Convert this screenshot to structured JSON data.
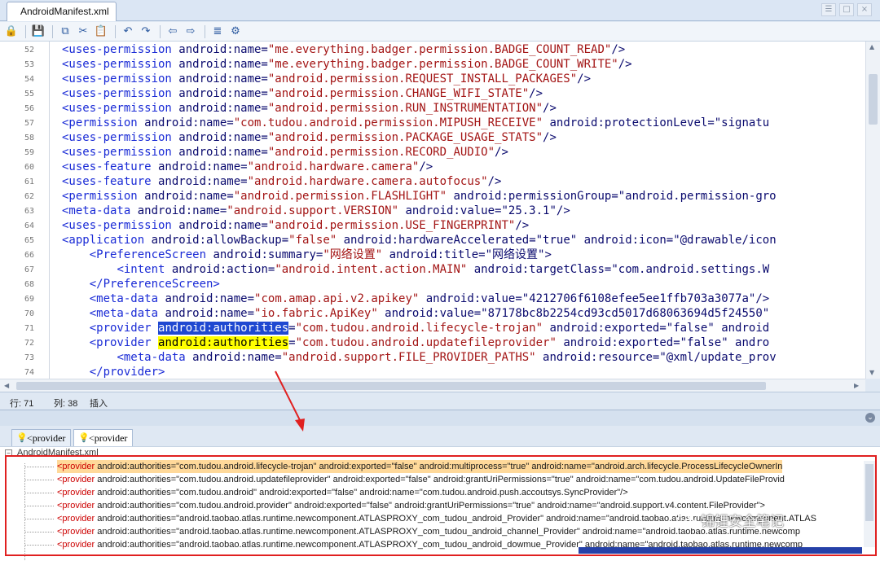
{
  "window": {
    "tab_title": "AndroidManifest.xml",
    "controls": [
      "☰",
      "□",
      "×"
    ]
  },
  "toolbar": {
    "icons": [
      {
        "name": "lock-icon",
        "glyph": "🔒"
      },
      {
        "name": "save-icon",
        "glyph": "💾"
      },
      {
        "name": "copy-icon",
        "glyph": "⧉"
      },
      {
        "name": "cut-icon",
        "glyph": "✂"
      },
      {
        "name": "paste-icon",
        "glyph": "📋"
      },
      {
        "name": "undo-icon",
        "glyph": "↶"
      },
      {
        "name": "redo-icon",
        "glyph": "↷"
      },
      {
        "name": "back-icon",
        "glyph": "⇦"
      },
      {
        "name": "forward-icon",
        "glyph": "⇨"
      },
      {
        "name": "format-icon",
        "glyph": "≣"
      },
      {
        "name": "tool-icon",
        "glyph": "⚙"
      }
    ]
  },
  "editor": {
    "lines": [
      {
        "n": "52",
        "indent": "",
        "tag": "<uses-permission",
        "rest": " android:name=",
        "val": "\"me.everything.badger.permission.BADGE_COUNT_READ\"",
        "tail": "/>"
      },
      {
        "n": "53",
        "indent": "",
        "tag": "<uses-permission",
        "rest": " android:name=",
        "val": "\"me.everything.badger.permission.BADGE_COUNT_WRITE\"",
        "tail": "/>"
      },
      {
        "n": "54",
        "indent": "",
        "tag": "<uses-permission",
        "rest": " android:name=",
        "val": "\"android.permission.REQUEST_INSTALL_PACKAGES\"",
        "tail": "/>"
      },
      {
        "n": "55",
        "indent": "",
        "tag": "<uses-permission",
        "rest": " android:name=",
        "val": "\"android.permission.CHANGE_WIFI_STATE\"",
        "tail": "/>"
      },
      {
        "n": "56",
        "indent": "",
        "tag": "<uses-permission",
        "rest": " android:name=",
        "val": "\"android.permission.RUN_INSTRUMENTATION\"",
        "tail": "/>"
      },
      {
        "n": "57",
        "indent": "",
        "tag": "<permission",
        "rest": " android:name=",
        "val": "\"com.tudou.android.permission.MIPUSH_RECEIVE\"",
        "tail": " android:protectionLevel=\"signatu"
      },
      {
        "n": "58",
        "indent": "",
        "tag": "<uses-permission",
        "rest": " android:name=",
        "val": "\"android.permission.PACKAGE_USAGE_STATS\"",
        "tail": "/>"
      },
      {
        "n": "59",
        "indent": "",
        "tag": "<uses-permission",
        "rest": " android:name=",
        "val": "\"android.permission.RECORD_AUDIO\"",
        "tail": "/>"
      },
      {
        "n": "60",
        "indent": "",
        "tag": "<uses-feature",
        "rest": " android:name=",
        "val": "\"android.hardware.camera\"",
        "tail": "/>"
      },
      {
        "n": "61",
        "indent": "",
        "tag": "<uses-feature",
        "rest": " android:name=",
        "val": "\"android.hardware.camera.autofocus\"",
        "tail": "/>"
      },
      {
        "n": "62",
        "indent": "",
        "tag": "<permission",
        "rest": " android:name=",
        "val": "\"android.permission.FLASHLIGHT\"",
        "tail": " android:permissionGroup=\"android.permission-gro"
      },
      {
        "n": "63",
        "indent": "",
        "tag": "<meta-data",
        "rest": " android:name=",
        "val": "\"android.support.VERSION\"",
        "tail": " android:value=\"25.3.1\"/>"
      },
      {
        "n": "64",
        "indent": "",
        "tag": "<uses-permission",
        "rest": " android:name=",
        "val": "\"android.permission.USE_FINGERPRINT\"",
        "tail": "/>"
      },
      {
        "n": "65",
        "indent": "",
        "tag": "<application",
        "rest": " android:allowBackup=",
        "val": "\"false\"",
        "tail": " android:hardwareAccelerated=\"true\" android:icon=\"@drawable/icon"
      },
      {
        "n": "66",
        "indent": "    ",
        "tag": "<PreferenceScreen",
        "rest": " android:summary=",
        "val": "\"网络设置\"",
        "tail": " android:title=\"网络设置\">"
      },
      {
        "n": "67",
        "indent": "        ",
        "tag": "<intent",
        "rest": " android:action=",
        "val": "\"android.intent.action.MAIN\"",
        "tail": " android:targetClass=\"com.android.settings.W"
      },
      {
        "n": "68",
        "indent": "    ",
        "tag": "</PreferenceScreen>",
        "rest": "",
        "val": "",
        "tail": ""
      },
      {
        "n": "69",
        "indent": "    ",
        "tag": "<meta-data",
        "rest": " android:name=",
        "val": "\"com.amap.api.v2.apikey\"",
        "tail": " android:value=\"4212706f6108efee5ee1ffb703a3077a\"/>"
      },
      {
        "n": "70",
        "indent": "    ",
        "tag": "<meta-data",
        "rest": " android:name=",
        "val": "\"io.fabric.ApiKey\"",
        "tail": " android:value=\"87178bc8b2254cd93cd5017d68063694d5f24550\""
      },
      {
        "n": "71",
        "indent": "    ",
        "tag": "<provider",
        "hl": "android:authorities",
        "hlclass": "hl-blue",
        "val": "\"com.tudou.android.lifecycle-trojan\"",
        "tail": " android:exported=\"false\" android"
      },
      {
        "n": "72",
        "indent": "    ",
        "tag": "<provider",
        "hl": "android:authorities",
        "hlclass": "hl-yellow",
        "val": "\"com.tudou.android.updatefileprovider\"",
        "tail": " android:exported=\"false\" andro"
      },
      {
        "n": "73",
        "indent": "        ",
        "tag": "<meta-data",
        "rest": " android:name=",
        "val": "\"android.support.FILE_PROVIDER_PATHS\"",
        "tail": " android:resource=\"@xml/update_prov"
      },
      {
        "n": "74",
        "indent": "    ",
        "tag": "</provider>",
        "rest": "",
        "val": "",
        "tail": ""
      }
    ]
  },
  "status": {
    "line": "行: 71",
    "col": "列: 38",
    "mode": "插入"
  },
  "results": {
    "tabs": [
      "<provider",
      "<provider"
    ],
    "file": "AndroidManifest.xml",
    "rows": [
      {
        "tag": "<provider",
        "body": " android:authorities=\"com.tudou.android.lifecycle-trojan\" android:exported=\"false\" android:multiprocess=\"true\" android:name=\"android.arch.lifecycle.ProcessLifecycleOwnerIn"
      },
      {
        "tag": "<provider",
        "body": " android:authorities=\"com.tudou.android.updatefileprovider\" android:exported=\"false\" android:grantUriPermissions=\"true\" android:name=\"com.tudou.android.UpdateFileProvid"
      },
      {
        "tag": "<provider",
        "body": " android:authorities=\"com.tudou.android\" android:exported=\"false\" android:name=\"com.tudou.android.push.accoutsys.SyncProvider\"/>"
      },
      {
        "tag": "<provider",
        "body": " android:authorities=\"com.tudou.android.provider\" android:exported=\"false\" android:grantUriPermissions=\"true\" android:name=\"android.support.v4.content.FileProvider\">"
      },
      {
        "tag": "<provider",
        "body": " android:authorities=\"android.taobao.atlas.runtime.newcomponent.ATLASPROXY_com_tudou_android_Provider\" android:name=\"android.taobao.atlas.runtime.newcomponent.ATLAS"
      },
      {
        "tag": "<provider",
        "body": " android:authorities=\"android.taobao.atlas.runtime.newcomponent.ATLASPROXY_com_tudou_android_channel_Provider\" android:name=\"android.taobao.atlas.runtime.newcomp"
      },
      {
        "tag": "<provider",
        "body": " android:authorities=\"android.taobao.atlas.runtime.newcomponent.ATLASPROXY_com_tudou_android_dowmue_Provider\" android:name=\"android.taobao.atlas.runtime.newcomp"
      }
    ]
  },
  "watermark": "锦锂安全笔记"
}
